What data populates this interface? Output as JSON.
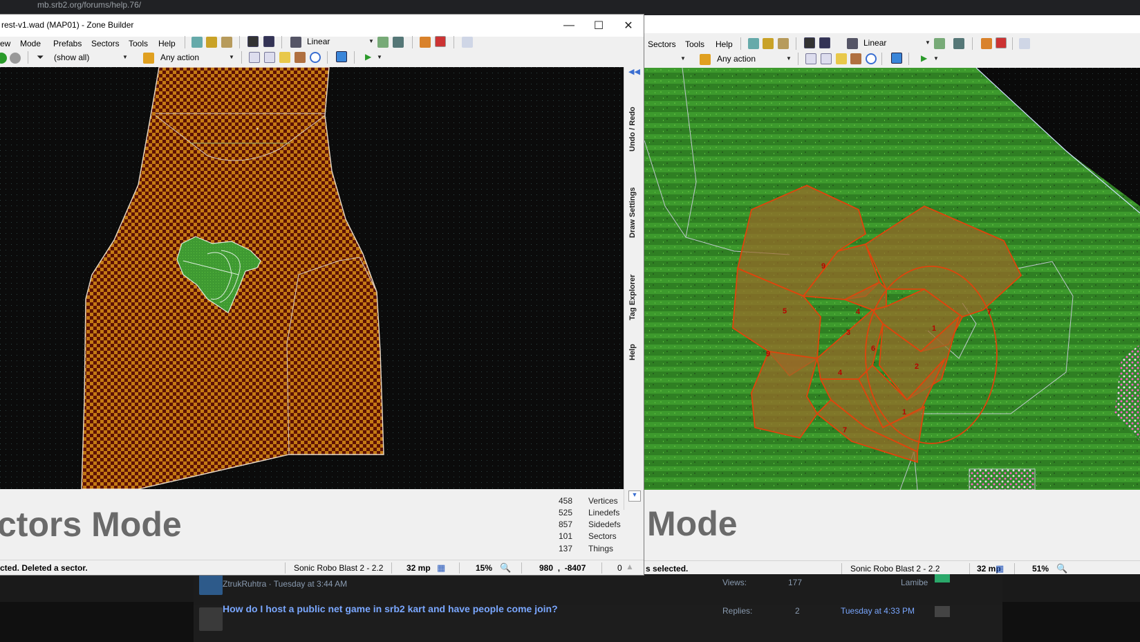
{
  "browser": {
    "url": "mb.srb2.org/forums/help.76/"
  },
  "forum": {
    "rows": [
      {
        "author_line": "ZtrukRuhtra · Tuesday at 3:44 AM",
        "stat_label": "Views:",
        "stat_value": "177",
        "last_user": "Lamibe"
      },
      {
        "title": "How do I host a public net game in srb2 kart and have people come join?",
        "stat_label": "Replies:",
        "stat_value": "2",
        "last_time": "Tuesday at 4:33 PM"
      }
    ]
  },
  "left_window": {
    "title": "rest-v1.wad (MAP01) - Zone Builder",
    "menu": [
      "ew",
      "Mode",
      "Prefabs",
      "Sectors",
      "Tools",
      "Help"
    ],
    "interpolation": "Linear",
    "filter": "(show all)",
    "action_filter": "Any action",
    "side_tabs": [
      "Undo / Redo",
      "Draw Settings",
      "Tag Explorer",
      "Help"
    ],
    "mode_title": "ctors Mode",
    "stats": [
      {
        "value": "458",
        "label": "Vertices"
      },
      {
        "value": "525",
        "label": "Linedefs"
      },
      {
        "value": "857",
        "label": "Sidedefs"
      },
      {
        "value": "101",
        "label": "Sectors"
      },
      {
        "value": "137",
        "label": "Things"
      }
    ],
    "status": {
      "message": "cted. Deleted a sector.",
      "game": "Sonic Robo Blast 2 - 2.2",
      "grid": "32 mp",
      "zoom": "15%",
      "coords": "980  ,  -8407",
      "extra": "0"
    },
    "colors": {
      "canvas_bg": "#0b0b0b",
      "checker_a": "#c47a14",
      "checker_b": "#5e1204",
      "grass": "#3f9a32"
    }
  },
  "right_window": {
    "menu": [
      "Sectors",
      "Tools",
      "Help"
    ],
    "interpolation": "Linear",
    "action_filter": "Any action",
    "mode_title": "Mode",
    "sector_tags": [
      "9",
      "5",
      "4",
      "3",
      "6",
      "1",
      "7",
      "9",
      "4",
      "2",
      "1",
      "7"
    ],
    "status": {
      "message": "s selected.",
      "game": "Sonic Robo Blast 2 - 2.2",
      "grid": "32 mp",
      "zoom": "51%"
    },
    "colors": {
      "grass_a": "#2e7d22",
      "grass_b": "#3c9a2c",
      "sector_fill": "#9a6a28",
      "sector_line": "#e0440c"
    }
  }
}
